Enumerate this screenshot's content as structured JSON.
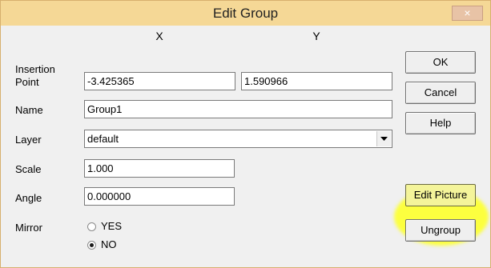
{
  "window": {
    "title": "Edit Group",
    "close_glyph": "×"
  },
  "form": {
    "col_x": "X",
    "col_y": "Y",
    "insertion_label_1": "Insertion",
    "insertion_label_2": "Point",
    "insertion_x": "-3.425365",
    "insertion_y": "1.590966",
    "name_label": "Name",
    "name_value": "Group1",
    "layer_label": "Layer",
    "layer_value": "default",
    "scale_label": "Scale",
    "scale_value": "1.000",
    "angle_label": "Angle",
    "angle_value": "0.000000",
    "mirror_label": "Mirror",
    "mirror_yes": "YES",
    "mirror_no": "NO",
    "mirror_selected": "NO"
  },
  "buttons": {
    "ok": "OK",
    "cancel": "Cancel",
    "help": "Help",
    "edit_picture": "Edit Picture",
    "ungroup": "Ungroup"
  },
  "colors": {
    "titlebar": "#f5d896",
    "highlight": "#fcff3f"
  }
}
